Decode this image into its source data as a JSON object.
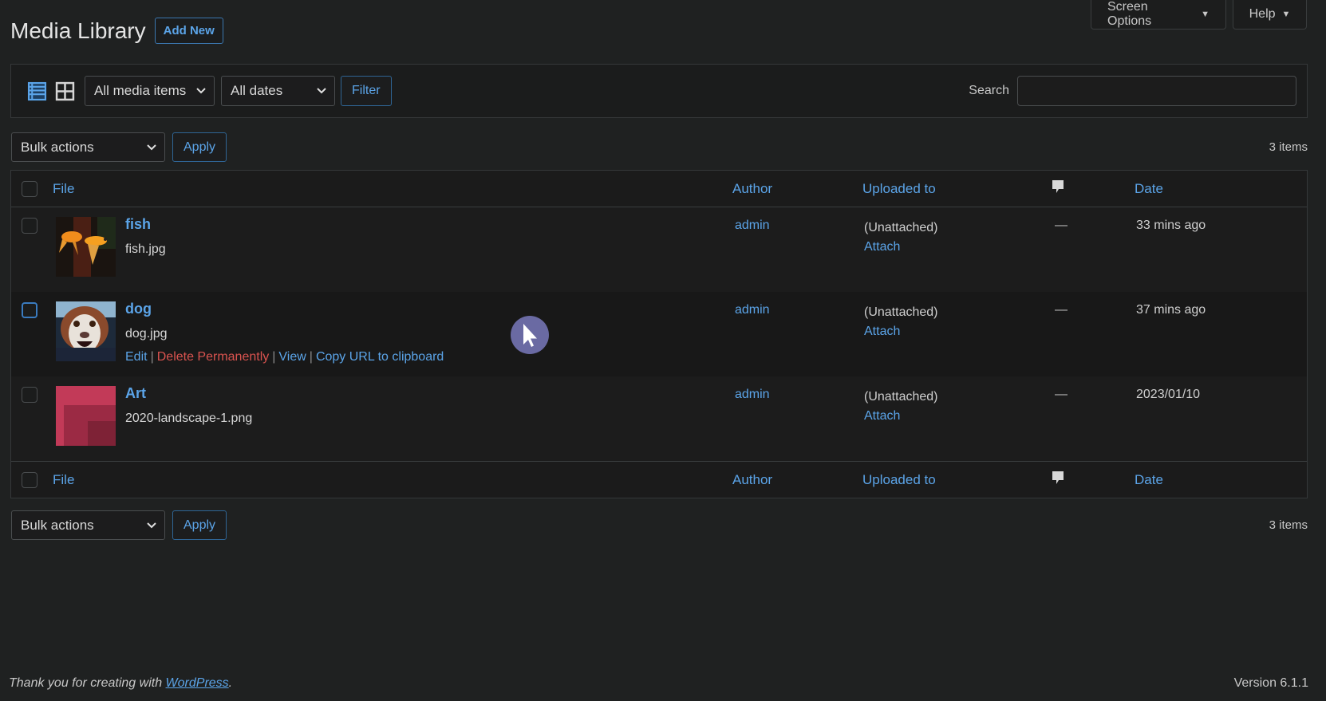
{
  "header": {
    "title": "Media Library",
    "add_new_label": "Add New",
    "screen_options_label": "Screen Options",
    "help_label": "Help",
    "dropdown_glyph": "▼"
  },
  "filters": {
    "view_list_icon": "list-view-icon",
    "view_grid_icon": "grid-view-icon",
    "media_type": "All media items",
    "date": "All dates",
    "filter_label": "Filter",
    "search_label": "Search",
    "search_value": "",
    "search_placeholder": ""
  },
  "bulk_top": {
    "select": "Bulk actions",
    "apply": "Apply",
    "count": "3 items"
  },
  "bulk_bottom": {
    "select": "Bulk actions",
    "apply": "Apply",
    "count": "3 items"
  },
  "table": {
    "columns": {
      "file": "File",
      "author": "Author",
      "uploaded_to": "Uploaded to",
      "comments_icon": "comment-bubble-icon",
      "date": "Date"
    },
    "rows": [
      {
        "title": "fish",
        "filename": "fish.jpg",
        "author": "admin",
        "uploaded_to": "(Unattached)",
        "attach": "Attach",
        "comments": "—",
        "date": "33 mins ago",
        "thumb": "goldfish-photo"
      },
      {
        "title": "dog",
        "filename": "dog.jpg",
        "author": "admin",
        "uploaded_to": "(Unattached)",
        "attach": "Attach",
        "comments": "—",
        "date": "37 mins ago",
        "thumb": "dog-photo",
        "actions": {
          "edit": "Edit",
          "delete": "Delete Permanently",
          "view": "View",
          "copy": "Copy URL to clipboard",
          "sep": "|"
        }
      },
      {
        "title": "Art",
        "filename": "2020-landscape-1.png",
        "author": "admin",
        "uploaded_to": "(Unattached)",
        "attach": "Attach",
        "comments": "—",
        "date": "2023/01/10",
        "thumb": "red-squares-art"
      }
    ]
  },
  "footer": {
    "thanks_prefix": "Thank you for creating with ",
    "wordpress_link": "WordPress",
    "thanks_suffix": ".",
    "version": "Version 6.1.1"
  },
  "colors": {
    "background": "#1f2121",
    "link": "#5ba4e8",
    "delete": "#d9534f",
    "cursor": "#6a6aa3"
  }
}
